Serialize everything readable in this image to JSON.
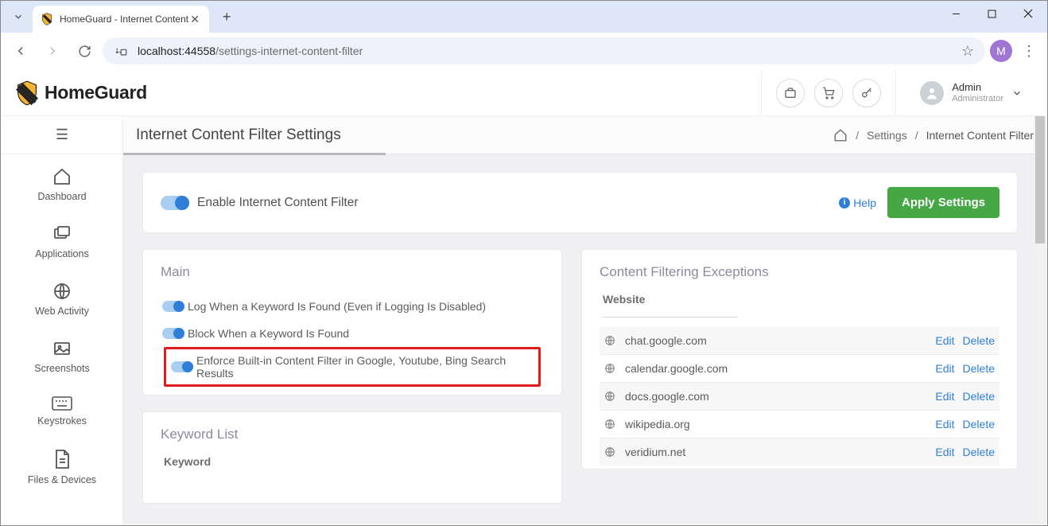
{
  "browser": {
    "tab_title": "HomeGuard - Internet Content",
    "url_host": "localhost:44558",
    "url_path": "/settings-internet-content-filter",
    "profile_initial": "M"
  },
  "header": {
    "brand": "HomeGuard",
    "user_name": "Admin",
    "user_role": "Administrator"
  },
  "sidebar": {
    "items": [
      {
        "label": "Dashboard"
      },
      {
        "label": "Applications"
      },
      {
        "label": "Web Activity"
      },
      {
        "label": "Screenshots"
      },
      {
        "label": "Keystrokes"
      },
      {
        "label": "Files & Devices"
      }
    ]
  },
  "page": {
    "title": "Internet Content Filter Settings",
    "crumb_settings": "Settings",
    "crumb_current": "Internet Content Filter"
  },
  "top_card": {
    "enable_label": "Enable Internet Content Filter",
    "help_label": "Help",
    "apply_label": "Apply Settings"
  },
  "main_panel": {
    "title": "Main",
    "opts": [
      "Log When a Keyword Is Found (Even if Logging Is Disabled)",
      "Block When a Keyword Is Found",
      "Enforce Built-in Content Filter in Google, Youtube, Bing Search Results"
    ]
  },
  "keyword_panel": {
    "title": "Keyword List",
    "col_header": "Keyword"
  },
  "exceptions": {
    "title": "Content Filtering Exceptions",
    "col_header": "Website",
    "edit_label": "Edit",
    "delete_label": "Delete",
    "rows": [
      "chat.google.com",
      "calendar.google.com",
      "docs.google.com",
      "wikipedia.org",
      "veridium.net"
    ]
  }
}
